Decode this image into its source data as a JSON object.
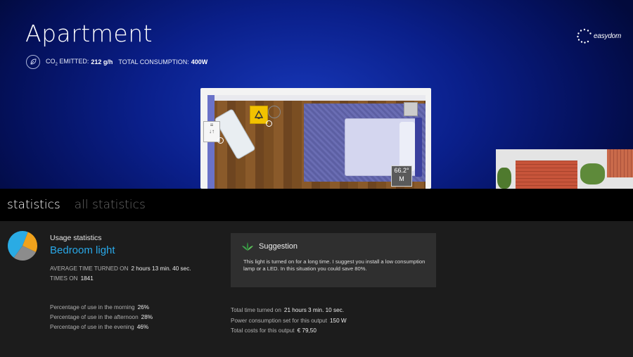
{
  "header": {
    "title": "Apartment",
    "co2_label_prefix": "CO",
    "co2_label_sub": "2",
    "co2_label_suffix": "EMITTED:",
    "co2_value": "212 g/h",
    "consumption_label": "TOTAL CONSUMPTION:",
    "consumption_value": "400W"
  },
  "logo": {
    "text": "easydom"
  },
  "floorplan": {
    "temperature_value": "66.2°",
    "temperature_unit": "M"
  },
  "tabs": [
    {
      "label": "statistics",
      "active": true
    },
    {
      "label": "all statistics",
      "active": false
    }
  ],
  "usage": {
    "section_title": "Usage statistics",
    "device_name": "Bedroom light",
    "avg_time_label": "AVERAGE TIME TURNED ON",
    "avg_time_value": "2 hours 13 min. 40 sec.",
    "times_on_label": "TIMES ON",
    "times_on_value": "1841",
    "pie_shares": {
      "morning": 26,
      "afternoon": 28,
      "evening": 46
    },
    "pie_colors": {
      "morning": "#f0a21c",
      "afternoon": "#8c8c8c",
      "evening": "#2aabe4"
    },
    "percentages": [
      {
        "label": "Percentage of use in the morning",
        "value": "26%"
      },
      {
        "label": "Percentage of use in the afternoon",
        "value": "28%"
      },
      {
        "label": "Percentage of use in the evening",
        "value": "46%"
      }
    ]
  },
  "suggestion": {
    "title": "Suggestion",
    "text": "This light is turned on for a long time. I suggest you install a low consumption lamp or a LED. In this situation you could save 80%."
  },
  "totals": [
    {
      "label": "Total time turned on",
      "value": "21 hours 3 min. 10 sec."
    },
    {
      "label": "Power consumption set for this output",
      "value": "150 W"
    },
    {
      "label": "Total costs for this output",
      "value": "€ 79,50"
    }
  ],
  "colors": {
    "accent": "#29a8e8",
    "tab_bar": "#000000",
    "panel": "#1c1c1c",
    "suggestion_bg": "#2f2f2f"
  }
}
